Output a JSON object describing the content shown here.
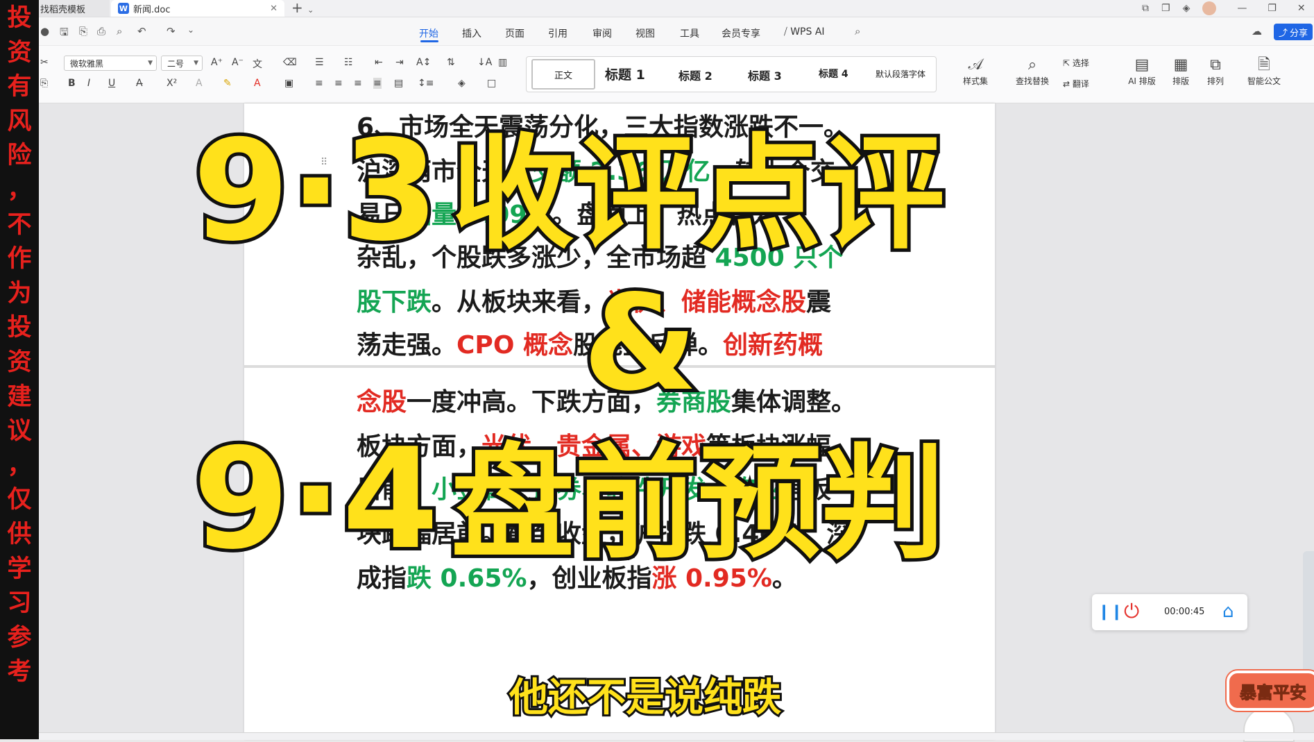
{
  "left_banner": {
    "chars": [
      "投",
      "资",
      "有",
      "风",
      "险",
      "，",
      "不",
      "作",
      "为",
      "投",
      "资",
      "建",
      "议",
      "，",
      "仅",
      "供",
      "学",
      "习",
      "参",
      "考"
    ]
  },
  "tabs": [
    {
      "label": "找稻壳模板"
    },
    {
      "label": "新闻.doc"
    }
  ],
  "menu_tabs": [
    "开始",
    "插入",
    "页面",
    "引用",
    "审阅",
    "视图",
    "工具",
    "会员专享",
    "WPS AI"
  ],
  "share_label": "分享",
  "ribbon": {
    "font_name": "微软雅黑",
    "font_size": "二号",
    "styles": [
      "正文",
      "标题 1",
      "标题 2",
      "标题 3",
      "标题 4",
      "默认段落字体"
    ],
    "style_set_label": "样式集",
    "tools": [
      "查找替换",
      "选择",
      "翻译",
      "AI 排版",
      "排版",
      "排列",
      "智能公文"
    ]
  },
  "document": {
    "lines": [
      [
        {
          "t": "6、市场全天震荡分化，三大指数涨跌不一。",
          "c": ""
        }
      ],
      [
        {
          "t": "沪深两市全天",
          "c": ""
        },
        {
          "t": "成交额 2.36 万亿",
          "c": "g"
        },
        {
          "t": "，较上个交",
          "c": ""
        }
      ],
      [
        {
          "t": "易日",
          "c": ""
        },
        {
          "t": "缩量 5.09",
          "c": "g"
        },
        {
          "t": "亿。盘面上，热点较为",
          "c": ""
        }
      ],
      [
        {
          "t": "杂乱，个股跌多涨少，全市场超 ",
          "c": ""
        },
        {
          "t": "4500 只个",
          "c": "g"
        }
      ],
      [
        {
          "t": "股下跌",
          "c": "g"
        },
        {
          "t": "。从板块来看，",
          "c": ""
        },
        {
          "t": "光伏、储能概念股",
          "c": "r"
        },
        {
          "t": "震",
          "c": ""
        }
      ],
      [
        {
          "t": "荡走强。",
          "c": ""
        },
        {
          "t": "CPO 概念",
          "c": "r"
        },
        {
          "t": "股尾盘反弹。",
          "c": ""
        },
        {
          "t": "创新药概",
          "c": "r"
        }
      ],
      [
        {
          "t": "念股",
          "c": "r"
        },
        {
          "t": "一度冲高。下跌方面，",
          "c": ""
        },
        {
          "t": "券商股",
          "c": "g"
        },
        {
          "t": "集体调整。",
          "c": ""
        }
      ],
      [
        {
          "t": "板块方面，",
          "c": ""
        },
        {
          "t": "光伏、贵金属、游戏",
          "c": "r"
        },
        {
          "t": "等板块涨幅",
          "c": ""
        }
      ],
      [
        {
          "t": "居前，",
          "c": ""
        },
        {
          "t": "小金属、证券、软件开发、农业",
          "c": "g"
        },
        {
          "t": "等板",
          "c": ""
        }
      ],
      [
        {
          "t": "块跌幅居前。截至收盘，沪指跌 0.46%，深",
          "c": ""
        }
      ],
      [
        {
          "t": "成指",
          "c": ""
        },
        {
          "t": "跌 0.65%",
          "c": "g"
        },
        {
          "t": "，创业板指",
          "c": ""
        },
        {
          "t": "涨 0.95%",
          "c": "r"
        },
        {
          "t": "。",
          "c": ""
        }
      ]
    ]
  },
  "overlay": {
    "line1_date": "9·3",
    "line1_text": "收评点评",
    "amp": "&",
    "line2_date": "9·4",
    "line2_text": "盘前预判"
  },
  "subtitle": "他还不是说纯跌",
  "recorder": {
    "time": "00:00:45"
  },
  "sticker": "暴富平安",
  "colors": {
    "accent": "#1f66e5",
    "green": "#14a553",
    "red": "#e22a22",
    "headline": "#ffe11b"
  }
}
